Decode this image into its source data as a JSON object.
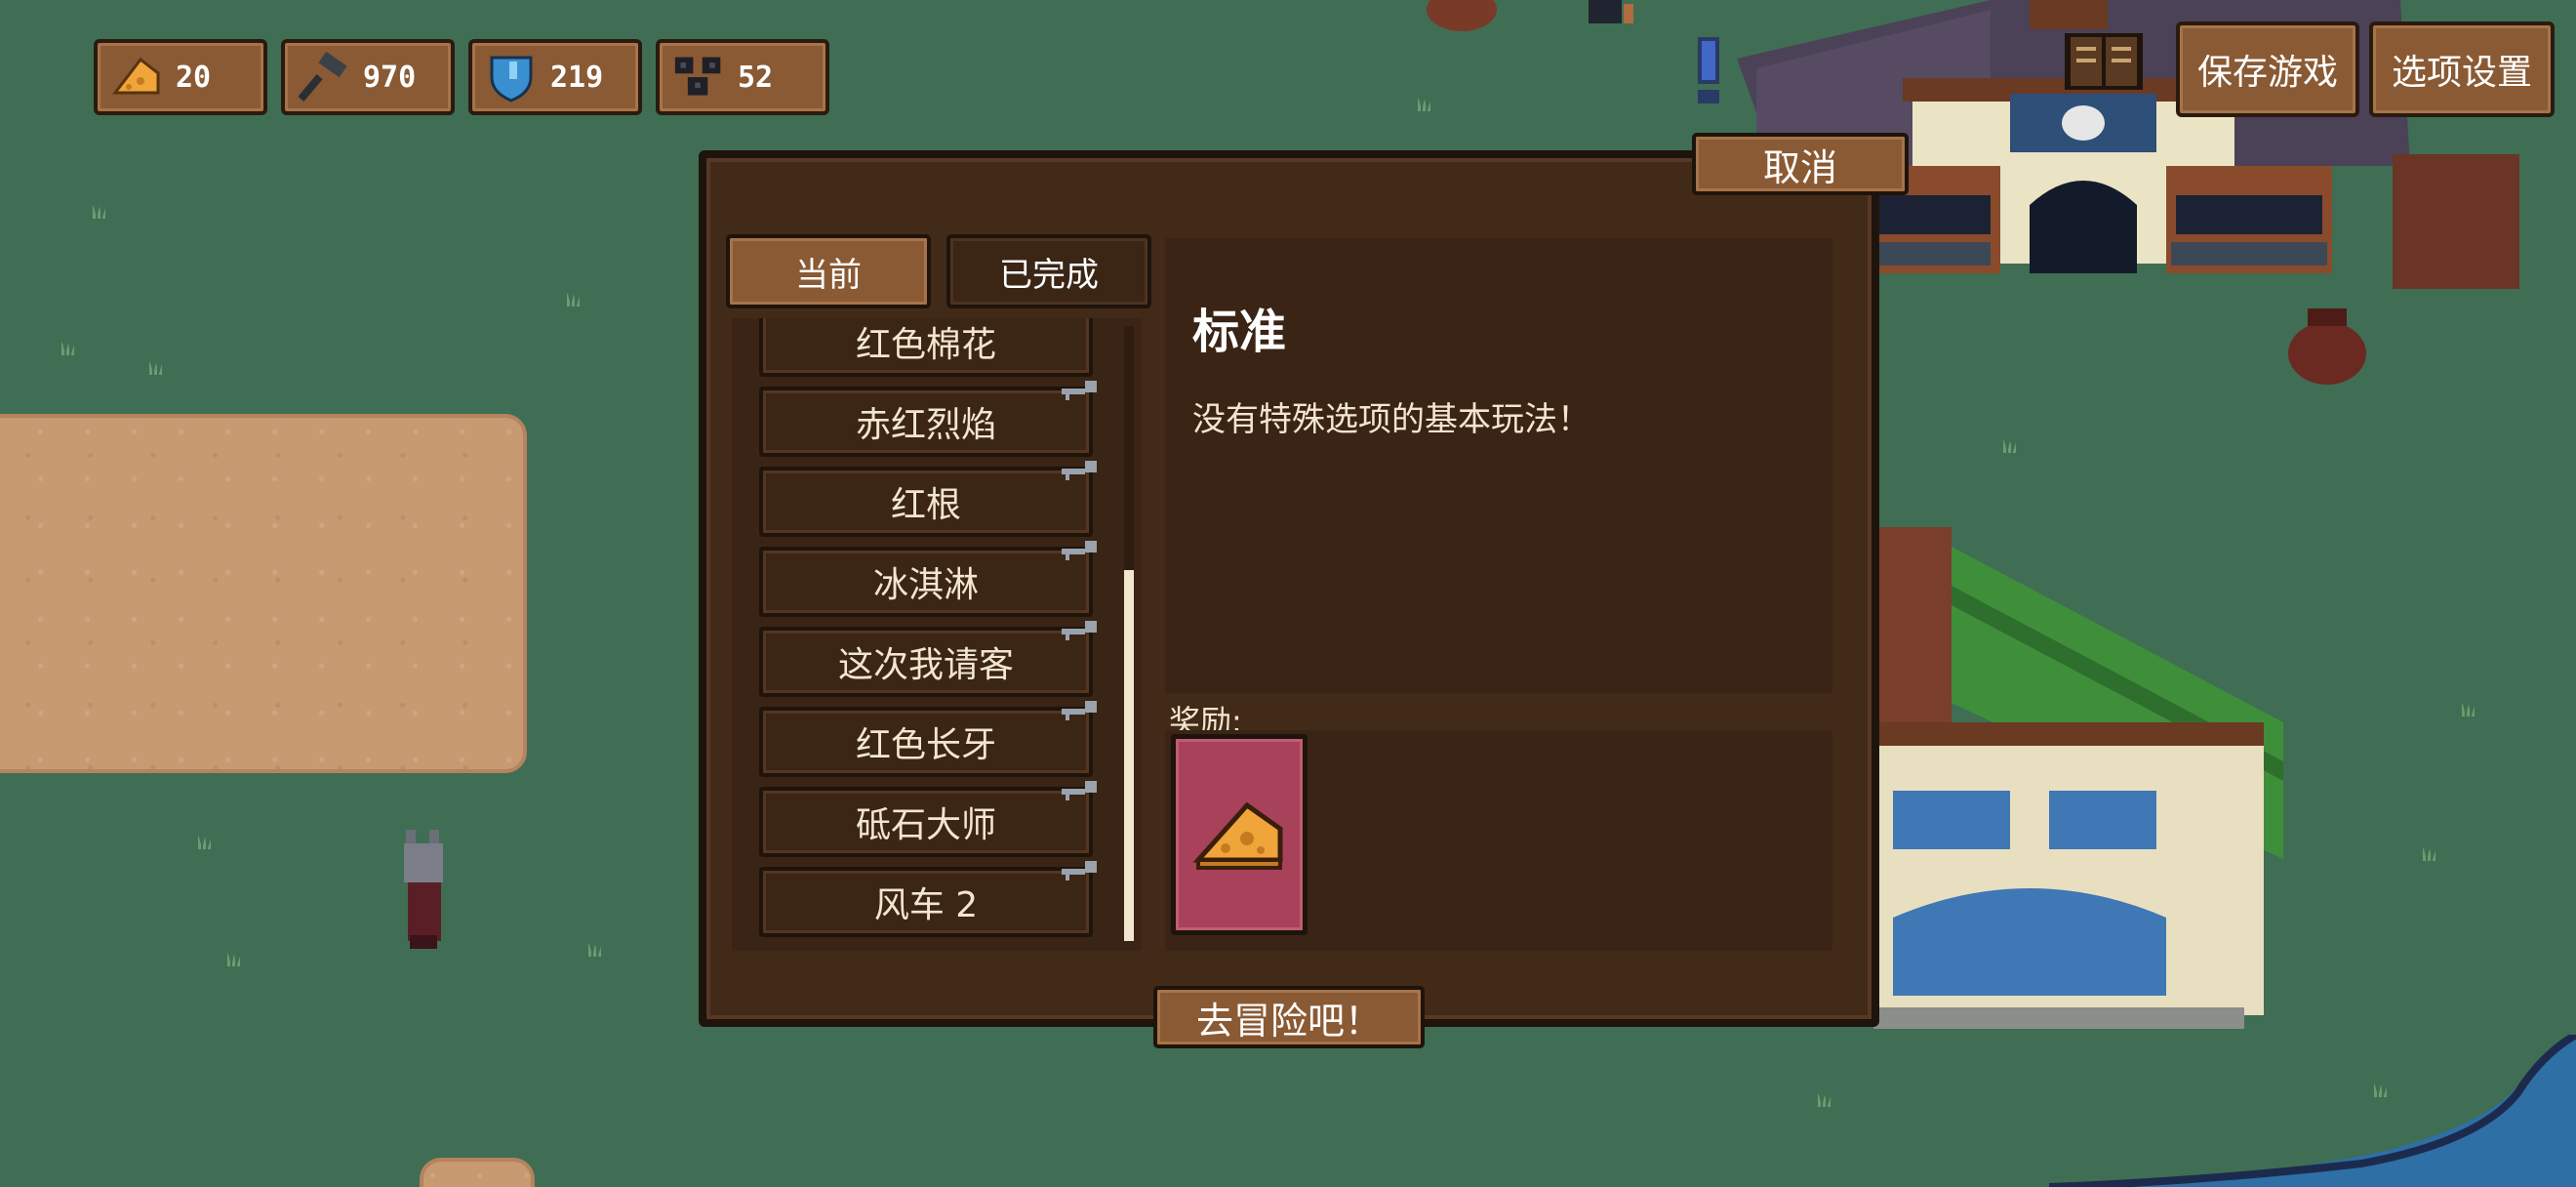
{
  "hud": {
    "resources": [
      {
        "icon": "cheese-icon",
        "value": "20"
      },
      {
        "icon": "hammer-icon",
        "value": "970"
      },
      {
        "icon": "shield-icon",
        "value": "219"
      },
      {
        "icon": "gear-cluster-icon",
        "value": "52"
      }
    ],
    "save_label": "保存游戏",
    "settings_label": "选项设置"
  },
  "dialog": {
    "cancel_label": "取消",
    "tabs": [
      {
        "label": "当前",
        "active": true
      },
      {
        "label": "已完成",
        "active": false
      }
    ],
    "challenges": [
      "红色棉花",
      "赤红烈焰",
      "红根",
      "冰淇淋",
      "这次我请客",
      "红色长牙",
      "砥石大师",
      "风车 2"
    ],
    "scroll_fraction": 1.0,
    "selected": {
      "title": "标准",
      "description": "没有特殊选项的基本玩法！"
    },
    "reward_label": "奖励:",
    "reward_item_icon": "cheese-icon",
    "go_label": "去冒险吧！"
  },
  "colors": {
    "grass": "#3f6e54",
    "wood": "#8a5a34",
    "panel": "#422a18",
    "reward_card": "#a8425a"
  }
}
